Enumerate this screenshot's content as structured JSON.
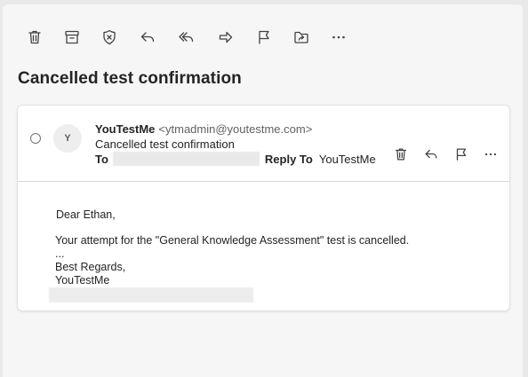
{
  "toolbar": {
    "items": [
      {
        "name": "delete-button",
        "icon": "trash-icon"
      },
      {
        "name": "archive-button",
        "icon": "archive-icon"
      },
      {
        "name": "report-button",
        "icon": "shield-x-icon"
      },
      {
        "name": "reply-button",
        "icon": "reply-icon"
      },
      {
        "name": "reply-all-button",
        "icon": "reply-all-icon"
      },
      {
        "name": "forward-button",
        "icon": "forward-icon"
      },
      {
        "name": "flag-button",
        "icon": "flag-icon"
      },
      {
        "name": "move-button",
        "icon": "move-to-folder-icon"
      },
      {
        "name": "more-button",
        "icon": "more-horizontal-icon"
      }
    ]
  },
  "email": {
    "subject": "Cancelled test confirmation",
    "avatar_initial": "Y",
    "sender_name": "YouTestMe",
    "sender_email": "<ytmadmin@youtestme.com>",
    "subject_line": "Cancelled test confirmation",
    "to_label": "To",
    "reply_to_label": "Reply To",
    "reply_to_value": "YouTestMe",
    "body": {
      "greeting": "Dear Ethan,",
      "line1": "Your attempt for the \"General Knowledge Assessment\" test is cancelled.",
      "line2": "...",
      "line3": "Best Regards,",
      "line4": "YouTestMe"
    }
  },
  "colors": {
    "icon": "#424242",
    "text": "#242424",
    "muted": "#616161",
    "background": "#f6f6f6",
    "card": "#ffffff"
  }
}
